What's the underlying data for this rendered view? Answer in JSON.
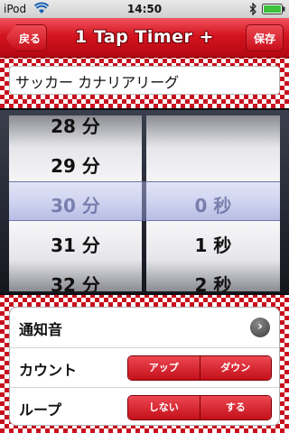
{
  "status_bar": {
    "carrier": "iPod",
    "time": "14:50"
  },
  "nav": {
    "back_label": "戻る",
    "title": "1 Tap Timer +",
    "save_label": "保存"
  },
  "name_field": {
    "value": "サッカー カナリアリーグ"
  },
  "picker": {
    "minutes": [
      "28 分",
      "29 分",
      "30 分",
      "31 分",
      "32 分"
    ],
    "minutes_selected": "30 分",
    "seconds": [
      "",
      "",
      "0 秒",
      "1 秒",
      "2 秒"
    ],
    "seconds_selected": "0 秒"
  },
  "settings": {
    "sound_label": "通知音",
    "count_label": "カウント",
    "count_options": [
      "アップ",
      "ダウン"
    ],
    "loop_label": "ループ",
    "loop_options": [
      "しない",
      "する"
    ]
  },
  "colors": {
    "accent_red": "#d5141f",
    "check_red": "#c8101e"
  }
}
